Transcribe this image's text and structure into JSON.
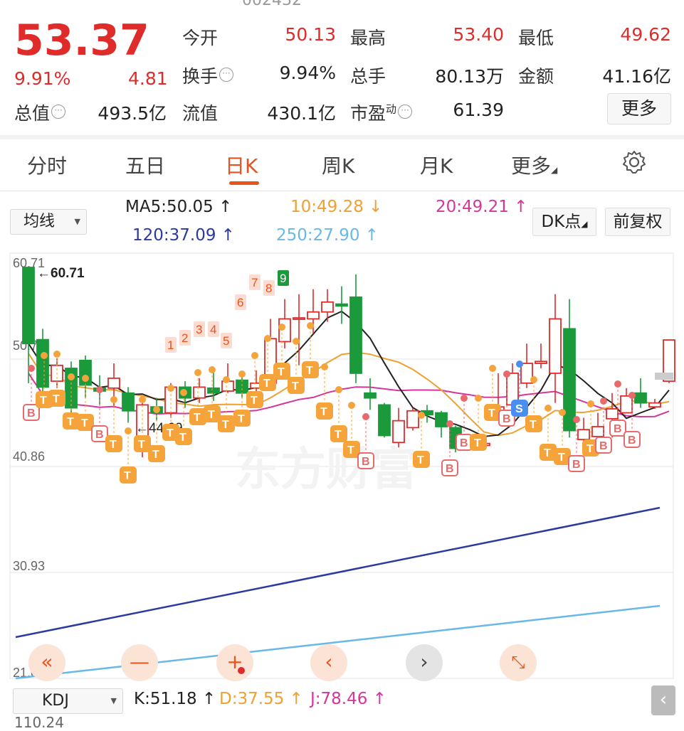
{
  "quote": {
    "price": "53.37",
    "change_pct": "9.91%",
    "change": "4.81",
    "rows": [
      [
        {
          "label": "今开",
          "value": "50.13",
          "color": "red"
        },
        {
          "label": "最高",
          "value": "53.40",
          "color": "red"
        },
        {
          "label": "最低",
          "value": "49.62",
          "color": "red"
        }
      ],
      [
        {
          "label": "换手",
          "value": "9.94%",
          "color": "dark"
        },
        {
          "label": "总手",
          "value": "80.13万",
          "color": "dark"
        },
        {
          "label": "金额",
          "value": "41.16亿",
          "color": "dark"
        }
      ],
      [
        {
          "label": "流值",
          "value": "430.1亿",
          "color": "dark"
        },
        {
          "label": "市盈",
          "value": "61.39",
          "color": "dark"
        }
      ]
    ],
    "total_value_label": "总值",
    "total_value": "493.5亿",
    "pe_sup": "动",
    "more_label": "更多"
  },
  "tabs": [
    "分时",
    "五日",
    "日K",
    "周K",
    "月K",
    "更多"
  ],
  "active_tab": "日K",
  "indicator": {
    "ma_select": "均线",
    "ma5": "MA5:50.05 ↑",
    "ma10": "10:49.28 ↓",
    "ma20": "20:49.21 ↑",
    "ma120": "120:37.09 ↑",
    "ma250": "250:27.90 ↑",
    "dk_label": "DK点",
    "fq_label": "前复权",
    "colors": {
      "ma5": "#222222",
      "ma10": "#f0a030",
      "ma20": "#d6359b",
      "ma120": "#2b3a9e",
      "ma250": "#68b8e8",
      "up": "#e02b2b",
      "down": "#1a9a3a"
    }
  },
  "chart_data": {
    "type": "candlestick",
    "y_labels": [
      "60.71",
      "50.78",
      "40.86",
      "30.93",
      "21.00"
    ],
    "annotations": [
      "←60.71",
      "←44.69"
    ],
    "badges": [
      "1",
      "2",
      "3",
      "4",
      "5",
      "6",
      "7",
      "8",
      "9",
      "T",
      "B",
      "S"
    ],
    "candles": [
      {
        "o": 60.71,
        "c": 53.0,
        "h": 60.71,
        "l": 49.0,
        "up": false
      },
      {
        "o": 53.4,
        "c": 48.6,
        "h": 54.5,
        "l": 48.0,
        "up": false
      },
      {
        "o": 49.2,
        "c": 50.8,
        "h": 51.5,
        "l": 48.5,
        "up": true
      },
      {
        "o": 50.5,
        "c": 46.5,
        "h": 51.2,
        "l": 46.0,
        "up": false
      },
      {
        "o": 51.3,
        "c": 48.8,
        "h": 51.8,
        "l": 47.5,
        "up": false
      },
      {
        "o": 48.5,
        "c": 48.2,
        "h": 49.8,
        "l": 46.8,
        "up": false
      },
      {
        "o": 48.5,
        "c": 49.5,
        "h": 51.0,
        "l": 46.5,
        "up": true
      },
      {
        "o": 48.0,
        "c": 46.2,
        "h": 48.6,
        "l": 45.0,
        "up": false
      },
      {
        "o": 42.8,
        "c": 46.8,
        "h": 47.0,
        "l": 41.5,
        "up": true
      },
      {
        "o": 46.6,
        "c": 46.0,
        "h": 47.5,
        "l": 45.2,
        "up": false
      },
      {
        "o": 46.0,
        "c": 48.6,
        "h": 49.0,
        "l": 45.5,
        "up": true
      },
      {
        "o": 48.6,
        "c": 47.5,
        "h": 49.2,
        "l": 46.5,
        "up": false
      },
      {
        "o": 47.5,
        "c": 48.6,
        "h": 49.5,
        "l": 47.0,
        "up": true
      },
      {
        "o": 48.5,
        "c": 48.0,
        "h": 50.5,
        "l": 47.2,
        "up": false
      },
      {
        "o": 48.2,
        "c": 49.2,
        "h": 51.0,
        "l": 48.0,
        "up": true
      },
      {
        "o": 49.3,
        "c": 48.0,
        "h": 50.0,
        "l": 47.5,
        "up": false
      },
      {
        "o": 48.5,
        "c": 49.0,
        "h": 50.3,
        "l": 47.8,
        "up": true
      },
      {
        "o": 49.0,
        "c": 53.5,
        "h": 55.5,
        "l": 48.5,
        "up": true
      },
      {
        "o": 53.2,
        "c": 55.5,
        "h": 57.5,
        "l": 52.5,
        "up": true
      },
      {
        "o": 55.5,
        "c": 55.6,
        "h": 58.0,
        "l": 50.8,
        "up": true
      },
      {
        "o": 55.5,
        "c": 56.2,
        "h": 58.5,
        "l": 54.0,
        "up": true
      },
      {
        "o": 56.2,
        "c": 57.2,
        "h": 58.5,
        "l": 55.2,
        "up": true
      },
      {
        "o": 57.0,
        "c": 56.8,
        "h": 58.8,
        "l": 55.0,
        "up": false
      },
      {
        "o": 57.7,
        "c": 50.0,
        "h": 60.0,
        "l": 49.0,
        "up": false
      },
      {
        "o": 48.0,
        "c": 47.5,
        "h": 49.5,
        "l": 46.3,
        "up": false
      },
      {
        "o": 46.8,
        "c": 43.7,
        "h": 47.0,
        "l": 43.5,
        "up": false
      },
      {
        "o": 43.0,
        "c": 45.2,
        "h": 46.5,
        "l": 42.5,
        "up": true
      },
      {
        "o": 44.5,
        "c": 46.2,
        "h": 46.5,
        "l": 44.2,
        "up": true
      },
      {
        "o": 46.2,
        "c": 45.8,
        "h": 46.8,
        "l": 45.0,
        "up": false
      },
      {
        "o": 46.0,
        "c": 44.6,
        "h": 46.2,
        "l": 43.5,
        "up": false
      },
      {
        "o": 44.5,
        "c": 42.4,
        "h": 44.7,
        "l": 42.0,
        "up": false
      },
      {
        "o": 43.0,
        "c": 42.5,
        "h": 43.2,
        "l": 42.2,
        "up": false
      },
      {
        "o": 42.9,
        "c": 42.7,
        "h": 43.2,
        "l": 42.4,
        "up": true
      },
      {
        "o": 45.7,
        "c": 46.6,
        "h": 50.0,
        "l": 45.5,
        "up": true
      },
      {
        "o": 46.8,
        "c": 50.0,
        "h": 51.0,
        "l": 46.0,
        "up": true
      },
      {
        "o": 49.0,
        "c": 51.0,
        "h": 53.0,
        "l": 48.5,
        "up": true
      },
      {
        "o": 51.0,
        "c": 51.2,
        "h": 53.0,
        "l": 50.5,
        "up": true
      },
      {
        "o": 50.0,
        "c": 55.5,
        "h": 58.0,
        "l": 47.0,
        "up": true
      },
      {
        "o": 54.5,
        "c": 44.2,
        "h": 57.5,
        "l": 43.5,
        "up": false
      },
      {
        "o": 43.3,
        "c": 44.3,
        "h": 45.5,
        "l": 42.5,
        "up": true
      },
      {
        "o": 43.6,
        "c": 44.6,
        "h": 46.0,
        "l": 42.0,
        "up": true
      },
      {
        "o": 45.4,
        "c": 46.4,
        "h": 48.0,
        "l": 43.5,
        "up": true
      },
      {
        "o": 46.0,
        "c": 47.7,
        "h": 48.5,
        "l": 46.0,
        "up": true
      },
      {
        "o": 48.0,
        "c": 47.0,
        "h": 49.5,
        "l": 46.5,
        "up": false
      },
      {
        "o": 46.6,
        "c": 47.0,
        "h": 47.4,
        "l": 46.4,
        "up": true
      },
      {
        "o": 49.2,
        "c": 53.37,
        "h": 53.4,
        "l": 49.0,
        "up": true
      }
    ]
  },
  "controls": [
    "«",
    "—",
    "+",
    "‹",
    "›",
    "⤡"
  ],
  "kdj": {
    "select": "KDJ",
    "k": "K:51.18 ↑",
    "d": "D:37.55 ↑",
    "j": "J:78.46 ↑",
    "colors": {
      "k": "#222222",
      "d": "#f0a030",
      "j": "#d6359b"
    }
  },
  "bottom_value": "110.24",
  "collapse_label": "‹"
}
